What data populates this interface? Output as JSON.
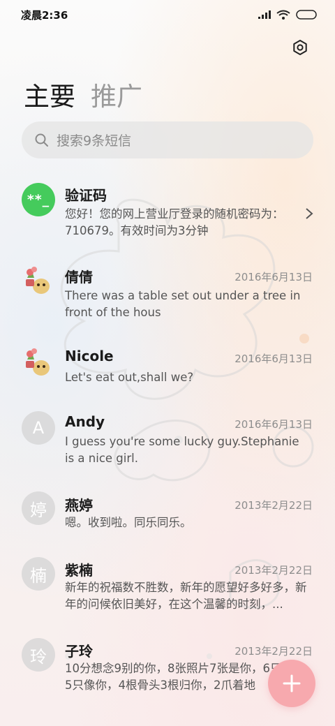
{
  "status_bar": {
    "time": "凌晨2:36"
  },
  "tabs": [
    {
      "label": "主要"
    },
    {
      "label": "推广"
    }
  ],
  "search": {
    "placeholder": "搜索9条短信"
  },
  "threads": [
    {
      "name": "验证码",
      "avatar": "**_",
      "avatar_style": "green",
      "date": "",
      "preview": "您好！您的网上营业厅登录的随机密码为：710679。有效时间为3分钟"
    },
    {
      "name": "倩倩",
      "avatar": "sticker",
      "avatar_style": "sticker",
      "date": "2016年6月13日",
      "preview": "There was a table set out under a tree in front of the hous"
    },
    {
      "name": "Nicole",
      "avatar": "sticker",
      "avatar_style": "sticker",
      "date": "2016年6月13日",
      "preview": "Let's eat out,shall we?"
    },
    {
      "name": "Andy",
      "avatar": "A",
      "avatar_style": "letter",
      "date": "2016年6月13日",
      "preview": "I guess you're some lucky guy.Stephanie is a nice girl."
    },
    {
      "name": "燕婷",
      "avatar": "婷",
      "avatar_style": "letter",
      "date": "2013年2月22日",
      "preview": "嗯。收到啦。同乐同乐。"
    },
    {
      "name": "紫楠",
      "avatar": "楠",
      "avatar_style": "letter",
      "date": "2013年2月22日",
      "preview": "新年的祝福数不胜数，新年的愿望好多好多，新年的问候依旧美好，在这个温馨的时刻，..."
    },
    {
      "name": "子玲",
      "avatar": "玲",
      "avatar_style": "letter",
      "date": "2013年2月22日",
      "preview": "10分想念9别的你，8张照片7张是你，6只小狗5只像你，4根骨头3根归你，2爪着地"
    }
  ],
  "icons": {
    "settings": "gear-icon",
    "search": "search-icon",
    "chevron": "chevron-right-icon",
    "fab": "plus-icon"
  },
  "colors": {
    "accent_green": "#45cb5c",
    "fab": "#f7a9ae"
  }
}
